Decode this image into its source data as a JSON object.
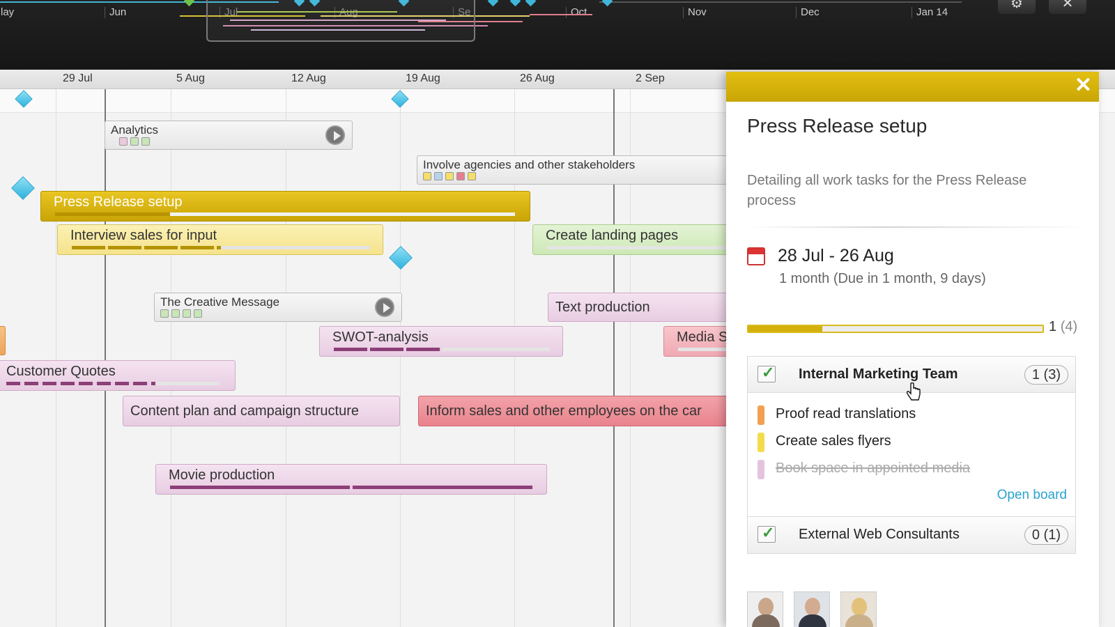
{
  "overview": {
    "months": [
      "lay",
      "Jun",
      "Jul",
      "Aug",
      "Se",
      "Oct",
      "Nov",
      "Dec",
      "Jan 14"
    ],
    "settings_icon": "gear-icon",
    "close_icon": "close-icon"
  },
  "timeline": {
    "dates": [
      "29 Jul",
      "5 Aug",
      "12 Aug",
      "19 Aug",
      "26 Aug",
      "2 Sep"
    ],
    "tasks": {
      "analytics": "Analytics",
      "involve": "Involve agencies and other stakeholders",
      "press_release": "Press Release setup",
      "interview": "Interview sales for input",
      "landing": "Create landing pages",
      "creative": "The Creative Message",
      "text_production": "Text production",
      "swot": "SWOT-analysis",
      "media": "Media S",
      "quotes": "Customer Quotes",
      "content_plan": "Content plan and campaign structure",
      "inform": "Inform sales and other employees on the car",
      "movie": "Movie production"
    },
    "progress": {
      "press_release": 0.25,
      "interview": 0.5,
      "swot": 0.5,
      "quotes": 0.7,
      "movie": 1.0
    }
  },
  "panel": {
    "close_label": "✕",
    "title": "Press Release setup",
    "description": "Detailing all work tasks for the Press Release process",
    "dates": "28 Jul - 26 Aug",
    "duration": "1 month  (Due in 1 month, 9 days)",
    "progress_fraction": 0.25,
    "count": "1",
    "count_total": "(4)",
    "teams": [
      {
        "name": "Internal Marketing Team",
        "badge": "1 (3)",
        "tasks": [
          {
            "label": "Proof read translations",
            "color": "#f0a050",
            "done": false
          },
          {
            "label": "Create sales flyers",
            "color": "#f2dc4a",
            "done": false
          },
          {
            "label": "Book space in appointed media",
            "color": "#e3c4df",
            "done": true
          }
        ],
        "open_board": "Open board"
      },
      {
        "name": "External Web Consultants",
        "badge": "0 (1)"
      }
    ]
  },
  "colors": {
    "accent_yellow": "#d3b00a",
    "milestone_blue": "#3fb6d9",
    "link_blue": "#2aa3cf"
  }
}
